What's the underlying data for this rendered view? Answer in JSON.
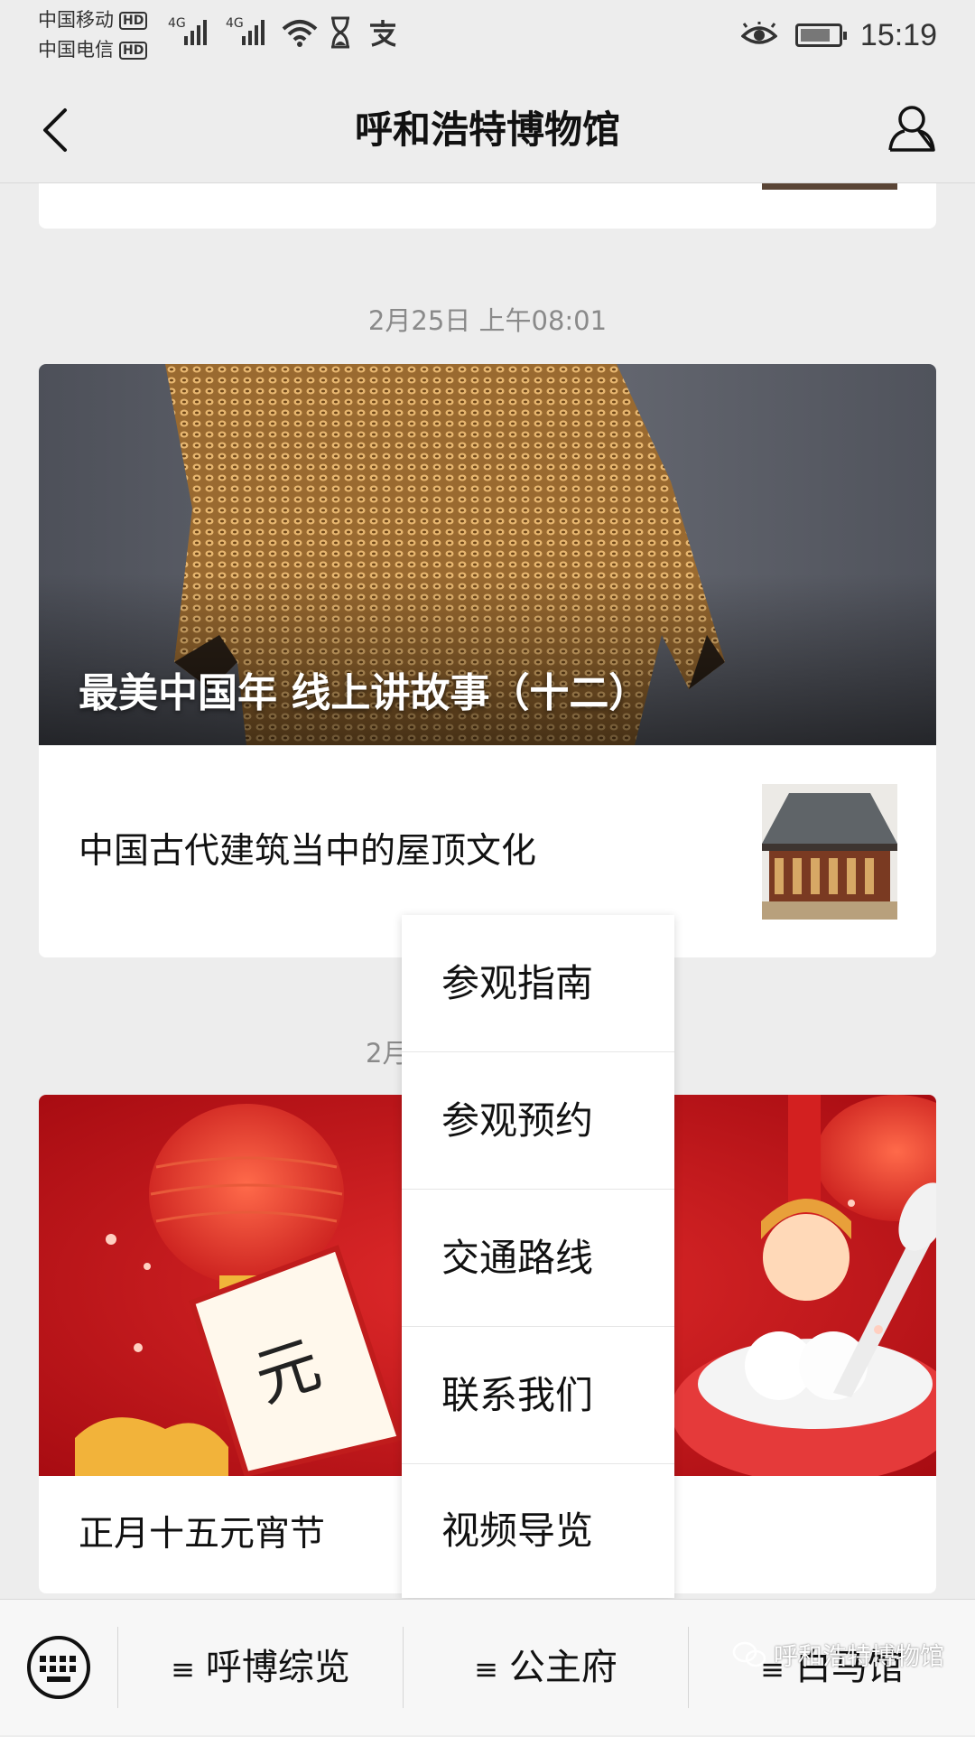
{
  "status_bar": {
    "carrier_1": "中国移动",
    "carrier_2": "中国电信",
    "hd_badge": "HD",
    "net_type": "4G",
    "time": "15:19"
  },
  "nav": {
    "title": "呼和浩特博物馆"
  },
  "feed": {
    "timestamp_1": "2月25日 上午08:01",
    "hero_title": "最美中国年 线上讲故事（十二）",
    "article_2": "中国古代建筑当中的屋顶文化",
    "timestamp_2_partial": "2月",
    "article_3": "正月十五元宵节"
  },
  "popup_menu": {
    "items": [
      "参观指南",
      "参观预约",
      "交通路线",
      "联系我们",
      "视频导览"
    ]
  },
  "bottom_menu": {
    "tabs": [
      "呼博综览",
      "公主府",
      "白马馆"
    ]
  },
  "watermark": "呼和浩特博物馆",
  "colors": {
    "background": "#ededed",
    "card": "#ffffff",
    "festival_red": "#c9141c"
  }
}
